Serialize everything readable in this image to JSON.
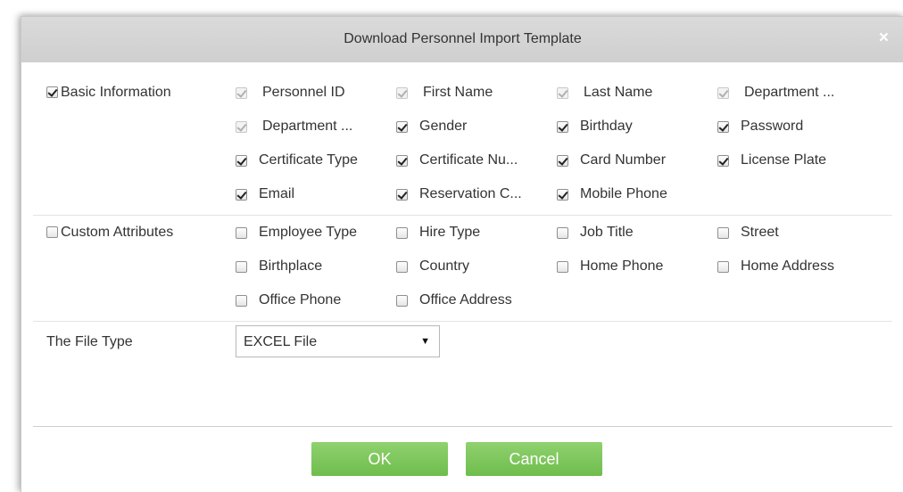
{
  "dialog": {
    "title": "Download Personnel Import Template",
    "close_glyph": "×"
  },
  "basic": {
    "label": "Basic Information",
    "checked": true,
    "fields": [
      {
        "label": "Personnel ID",
        "checked": true,
        "disabled": true
      },
      {
        "label": "First Name",
        "checked": true,
        "disabled": true
      },
      {
        "label": "Last Name",
        "checked": true,
        "disabled": true
      },
      {
        "label": "Department ...",
        "checked": true,
        "disabled": true
      },
      {
        "label": "Department ...",
        "checked": true,
        "disabled": true
      },
      {
        "label": "Gender",
        "checked": true,
        "disabled": false
      },
      {
        "label": "Birthday",
        "checked": true,
        "disabled": false
      },
      {
        "label": "Password",
        "checked": true,
        "disabled": false
      },
      {
        "label": "Certificate Type",
        "checked": true,
        "disabled": false
      },
      {
        "label": "Certificate Nu...",
        "checked": true,
        "disabled": false
      },
      {
        "label": "Card Number",
        "checked": true,
        "disabled": false
      },
      {
        "label": "License Plate",
        "checked": true,
        "disabled": false
      },
      {
        "label": "Email",
        "checked": true,
        "disabled": false
      },
      {
        "label": "Reservation C...",
        "checked": true,
        "disabled": false
      },
      {
        "label": "Mobile Phone",
        "checked": true,
        "disabled": false
      }
    ]
  },
  "custom": {
    "label": "Custom Attributes",
    "checked": false,
    "fields": [
      {
        "label": "Employee Type",
        "checked": false
      },
      {
        "label": "Hire Type",
        "checked": false
      },
      {
        "label": "Job Title",
        "checked": false
      },
      {
        "label": "Street",
        "checked": false
      },
      {
        "label": "Birthplace",
        "checked": false
      },
      {
        "label": "Country",
        "checked": false
      },
      {
        "label": "Home Phone",
        "checked": false
      },
      {
        "label": "Home Address",
        "checked": false
      },
      {
        "label": "Office Phone",
        "checked": false
      },
      {
        "label": "Office Address",
        "checked": false
      }
    ]
  },
  "file_type": {
    "label": "The File Type",
    "value": "EXCEL File",
    "arrow_glyph": "▼"
  },
  "buttons": {
    "ok": "OK",
    "cancel": "Cancel"
  },
  "colors": {
    "title_bar": "#d3d3d3",
    "button_green": "#7cc65a"
  }
}
